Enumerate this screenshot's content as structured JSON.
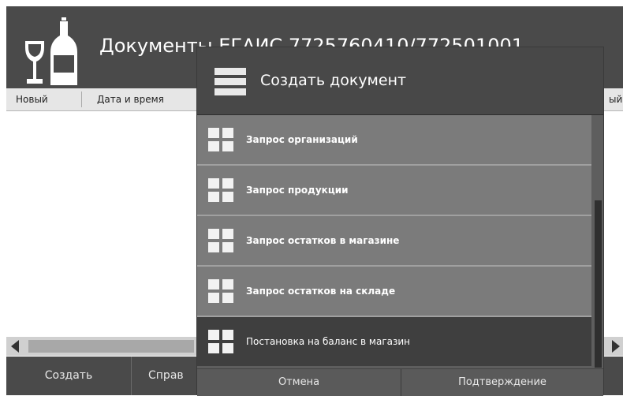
{
  "header": {
    "title": "Документы ЕГАИС 7725760410/772501001"
  },
  "table": {
    "columns": [
      "Новый",
      "Дата и время",
      "ый"
    ]
  },
  "toolbar": {
    "buttons": [
      "Создать",
      "Справ"
    ]
  },
  "modal": {
    "title": "Создать документ",
    "items": [
      {
        "label": "Запрос организаций"
      },
      {
        "label": "Запрос продукции"
      },
      {
        "label": "Запрос остатков в магазине"
      },
      {
        "label": "Запрос остатков на складе"
      },
      {
        "label": "Постановка на баланс в магазин"
      }
    ],
    "cancel_label": "Отмена",
    "confirm_label": "Подтверждение"
  },
  "colors": {
    "header_bg": "#4a4a4a",
    "list_item_bg": "#7b7b7b",
    "selected_item_bg": "#3f3f3f"
  }
}
